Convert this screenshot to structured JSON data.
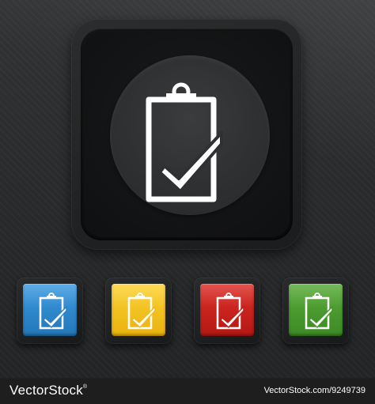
{
  "footer": {
    "brand_name": "VectorStock",
    "brand_mark": "®",
    "url": "VectorStock.com/9249739"
  },
  "icon": "clipboard-checkmark-icon",
  "buttons": [
    {
      "name": "black",
      "face_color": "#2e3032",
      "icon": "clipboard-checkmark-icon"
    },
    {
      "name": "blue",
      "face_color": "#2f86c9",
      "icon": "clipboard-checkmark-icon"
    },
    {
      "name": "yellow",
      "face_color": "#f4c21c",
      "icon": "clipboard-checkmark-icon"
    },
    {
      "name": "red",
      "face_color": "#c8201c",
      "icon": "clipboard-checkmark-icon"
    },
    {
      "name": "green",
      "face_color": "#4a9a2e",
      "icon": "clipboard-checkmark-icon"
    }
  ]
}
